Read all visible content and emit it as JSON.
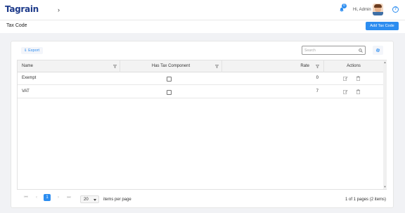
{
  "app": {
    "logo_text": "Tagrain",
    "greeting": "Hi, Admin",
    "notification_count": "0"
  },
  "page": {
    "title": "Tax Code",
    "add_button_label": "Add Tax Code"
  },
  "toolbar": {
    "export_label": "Export",
    "search_placeholder": "Search"
  },
  "table": {
    "columns": [
      "Name",
      "Has Tax Component",
      "Rate",
      "Actions"
    ],
    "rows": [
      {
        "name": "Exempt",
        "has_tax_component": false,
        "rate": "0"
      },
      {
        "name": "VAT",
        "has_tax_component": false,
        "rate": "7"
      }
    ]
  },
  "pager": {
    "current_page": "1",
    "page_size": "20",
    "items_per_page_label": "items per page",
    "info": "1 of 1 pages (2 items)"
  },
  "colors": {
    "accent": "#2c8df0",
    "brand": "#1d3a8a"
  }
}
